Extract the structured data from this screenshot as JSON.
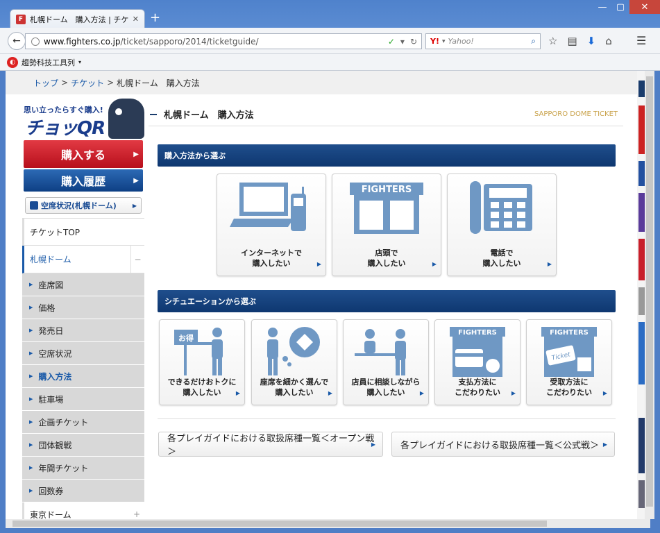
{
  "browser": {
    "tab_title": "札幌ドーム　購入方法 | チケ...",
    "url_host": "www.fighters.co.jp",
    "url_path": "/ticket/sapporo/2014/ticketguide/",
    "search_placeholder": "Yahoo!",
    "search_engine_logo": "Y!",
    "bookmark_label": "趨勢科技工具列",
    "win_min": "—",
    "win_max": "▢",
    "win_close": "✕",
    "new_tab": "+"
  },
  "breadcrumb": {
    "items": [
      "トップ",
      "チケット",
      "札幌ドーム　購入方法"
    ],
    "sep": ">"
  },
  "sidebar": {
    "qr_tagline": "思い立ったらすぐ購入!",
    "qr_logo": "チョッQR",
    "buy_label": "購入する",
    "history_label": "購入履歴",
    "availability_label": "空席状況(札幌ドーム)",
    "ticket_top": "チケットTOP",
    "section_sapporo": "札幌ドーム",
    "sub_items": [
      "座席図",
      "価格",
      "発売日",
      "空席状況",
      "購入方法",
      "駐車場",
      "企画チケット",
      "団体観戦",
      "年間チケット",
      "回数券"
    ],
    "section_tokyo": "東京ドーム",
    "minus": "−",
    "plus": "+"
  },
  "main": {
    "title": "札幌ドーム　購入方法",
    "title_en": "SAPPORO DOME TICKET",
    "section1": "購入方法から選ぶ",
    "methods": [
      {
        "line1": "インターネットで",
        "line2": "購入したい"
      },
      {
        "line1": "店頭で",
        "line2": "購入したい"
      },
      {
        "line1": "電話で",
        "line2": "購入したい"
      }
    ],
    "fighters_sign": "FIGHTERS",
    "section2": "シチュエーションから選ぶ",
    "situations": [
      {
        "line1": "できるだけおトクに",
        "line2": "購入したい",
        "tag": "お得"
      },
      {
        "line1": "座席を細かく選んで",
        "line2": "購入したい"
      },
      {
        "line1": "店員に相談しながら",
        "line2": "購入したい"
      },
      {
        "line1": "支払方法に",
        "line2": "こだわりたい"
      },
      {
        "line1": "受取方法に",
        "line2": "こだわりたい",
        "tag": "Ticket"
      }
    ],
    "link_open": "各プレイガイドにおける取扱席種一覧＜オープン戦＞",
    "link_official": "各プレイガイドにおける取扱席種一覧＜公式戦＞"
  },
  "colors": {
    "navy": "#0e3770",
    "icon_blue": "#6f98c4",
    "buy_red": "#c8202c",
    "link_blue": "#1a5aa8"
  }
}
